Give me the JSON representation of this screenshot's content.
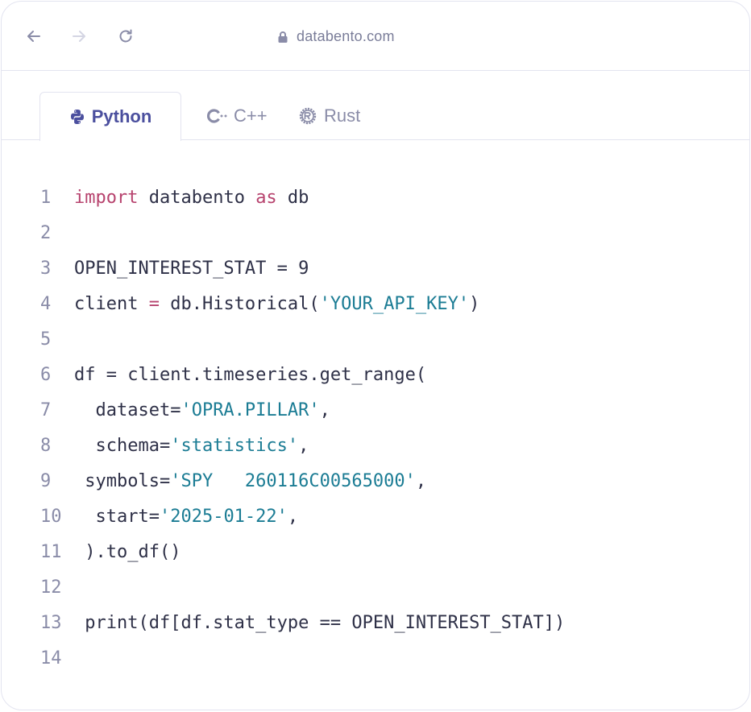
{
  "browser": {
    "url": "databento.com",
    "icons": {
      "back": "arrow-left-icon",
      "forward": "arrow-right-icon",
      "reload": "reload-icon",
      "lock": "lock-icon"
    }
  },
  "tabs": [
    {
      "label": "Python",
      "icon": "python-icon",
      "active": true
    },
    {
      "label": "C++",
      "icon": "cpp-icon",
      "active": false
    },
    {
      "label": "Rust",
      "icon": "rust-icon",
      "active": false
    }
  ],
  "colors": {
    "keyword": "#b7436e",
    "string": "#1b7c94",
    "text": "#2e3047",
    "line_number": "#8a8ca8",
    "active_tab": "#4b4f9e",
    "border": "#e3e4f0"
  },
  "code": {
    "lines": [
      {
        "n": "1",
        "segments": [
          {
            "t": "import",
            "c": "kw"
          },
          {
            "t": " databento "
          },
          {
            "t": "as",
            "c": "kw"
          },
          {
            "t": " db"
          }
        ]
      },
      {
        "n": "2",
        "segments": []
      },
      {
        "n": "3",
        "segments": [
          {
            "t": "OPEN_INTEREST_STAT = 9"
          }
        ]
      },
      {
        "n": "4",
        "segments": [
          {
            "t": "client "
          },
          {
            "t": "=",
            "c": "kw"
          },
          {
            "t": " db.Historical("
          },
          {
            "t": "'YOUR_API_KEY'",
            "c": "str"
          },
          {
            "t": ")"
          }
        ]
      },
      {
        "n": "5",
        "segments": []
      },
      {
        "n": "6",
        "segments": [
          {
            "t": "df = client.timeseries.get_range("
          }
        ]
      },
      {
        "n": "7",
        "segments": [
          {
            "t": "  dataset="
          },
          {
            "t": "'OPRA.PILLAR'",
            "c": "str"
          },
          {
            "t": ","
          }
        ]
      },
      {
        "n": "8",
        "segments": [
          {
            "t": "  schema="
          },
          {
            "t": "'statistics'",
            "c": "str"
          },
          {
            "t": ","
          }
        ]
      },
      {
        "n": "9",
        "segments": [
          {
            "t": " symbols="
          },
          {
            "t": "'SPY   260116C00565000'",
            "c": "str"
          },
          {
            "t": ","
          }
        ]
      },
      {
        "n": "10",
        "segments": [
          {
            "t": "  start="
          },
          {
            "t": "'2025-01-22'",
            "c": "str"
          },
          {
            "t": ","
          }
        ]
      },
      {
        "n": "11",
        "segments": [
          {
            "t": " ).to_df()"
          }
        ]
      },
      {
        "n": "12",
        "segments": []
      },
      {
        "n": "13",
        "segments": [
          {
            "t": " print(df[df.stat_type == OPEN_INTEREST_STAT])"
          }
        ]
      },
      {
        "n": "14",
        "segments": []
      }
    ]
  }
}
